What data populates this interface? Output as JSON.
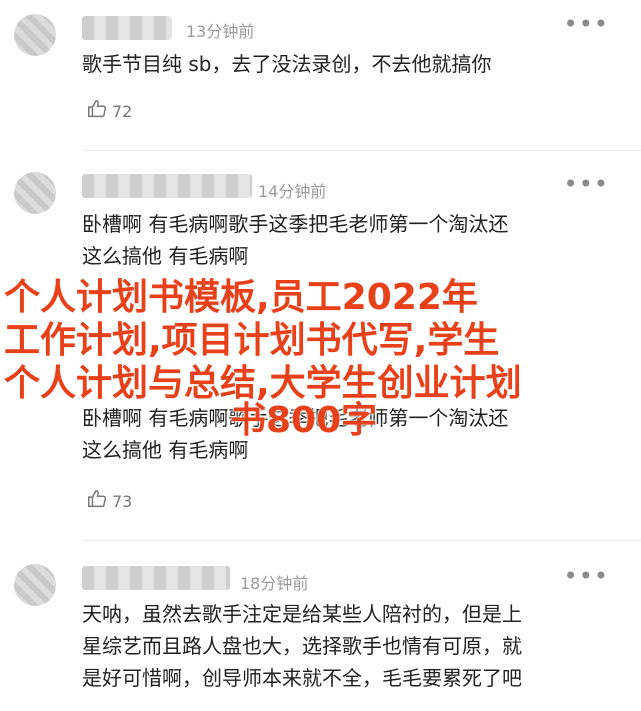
{
  "comments": [
    {
      "time": "13分钟前",
      "text": "歌手节目纯 sb，去了没法录创，不去他就搞你",
      "likes": "72"
    },
    {
      "time": "14分钟前",
      "text": "卧槽啊 有毛病啊歌手这季把毛老师第一个淘汰还\n这么搞他 有毛病啊",
      "likes": ""
    },
    {
      "time": "",
      "text": "卧槽啊 有毛病啊歌手这季把毛老师第一个淘汰还\n这么搞他 有毛病啊",
      "likes": "73"
    },
    {
      "time": "18分钟前",
      "text": "天呐，虽然去歌手注定是给某些人陪衬的，但是上\n星综艺而且路人盘也大，选择歌手也情有可原，就\n是好可惜啊，创导师本来就不全，毛毛要累死了吧",
      "likes": ""
    }
  ],
  "more_icon": "•••",
  "overlay": {
    "line1": "个人计划书模板,员工2022年",
    "line2": "工作计划,项目计划书代写,学生",
    "line3": "个人计划与总结,大学生创业计划",
    "line4": "书800字"
  }
}
